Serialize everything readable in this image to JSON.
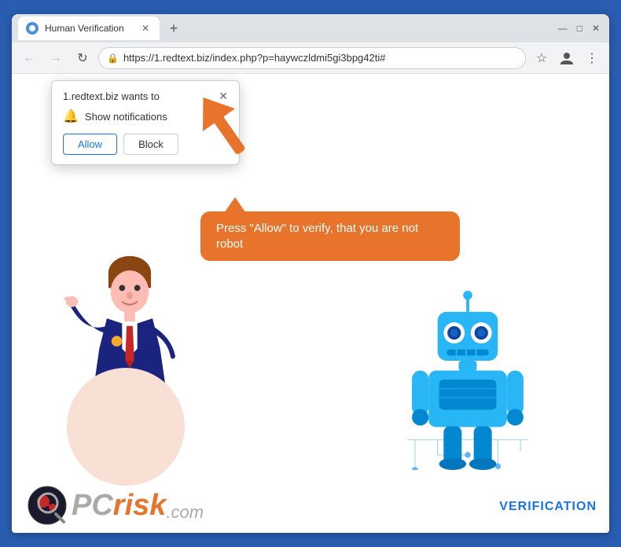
{
  "browser": {
    "title": "Human Verification",
    "url": "https://1.redtext.biz/index.php?p=haywczldmi5gi3bpg42ti#",
    "new_tab_icon": "+",
    "window_controls": {
      "minimize": "—",
      "maximize": "□",
      "close": "✕"
    }
  },
  "nav": {
    "back": "←",
    "forward": "→",
    "refresh": "↻"
  },
  "notification": {
    "title": "1.redtext.biz wants to",
    "label": "Show notifications",
    "close": "✕",
    "allow_btn": "Allow",
    "block_btn": "Block"
  },
  "speech": {
    "text": "Press \"Allow\" to verify, that you are not robot"
  },
  "logo": {
    "pc": "PC",
    "risk": "risk",
    "dotcom": ".com"
  },
  "verification": {
    "label": "VERIFICATION"
  },
  "icons": {
    "lock": "🔒",
    "star": "☆",
    "bell": "🔔",
    "profile": "👤",
    "menu": "⋮",
    "bell_notif": "🔔"
  }
}
